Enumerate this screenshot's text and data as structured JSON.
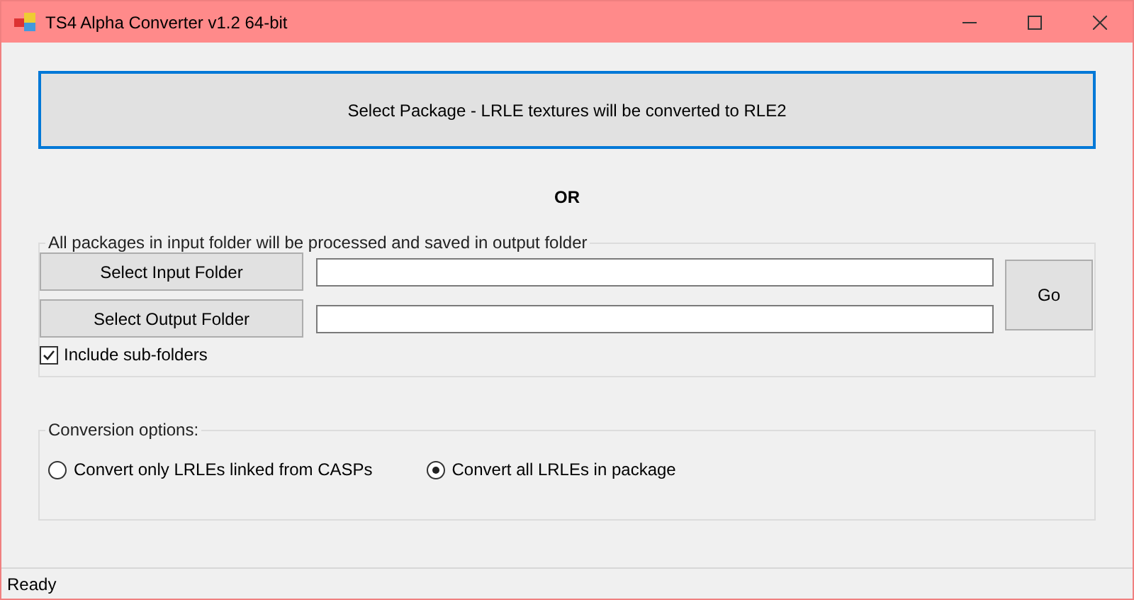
{
  "window": {
    "title": "TS4 Alpha Converter v1.2 64-bit"
  },
  "select_package_button": {
    "label": "Select Package - LRLE textures will be converted to RLE2",
    "focused": true
  },
  "separator_text": "OR",
  "folder_group": {
    "caption": "All packages in input folder will be processed and saved in output folder",
    "fields": [
      {
        "button": "Select Input Folder"
      },
      {
        "button": "Select Output Folder"
      }
    ],
    "go_button": "Go",
    "include_subfolders": {
      "label": "Include sub-folders",
      "checked": true
    }
  },
  "options_group": {
    "caption": "Conversion options:",
    "options": [
      {
        "label": "Convert only LRLEs linked from CASPs",
        "selected": false
      },
      {
        "label": "Convert all LRLEs in package",
        "selected": true
      }
    ]
  },
  "status_bar": {
    "text": "Ready"
  }
}
